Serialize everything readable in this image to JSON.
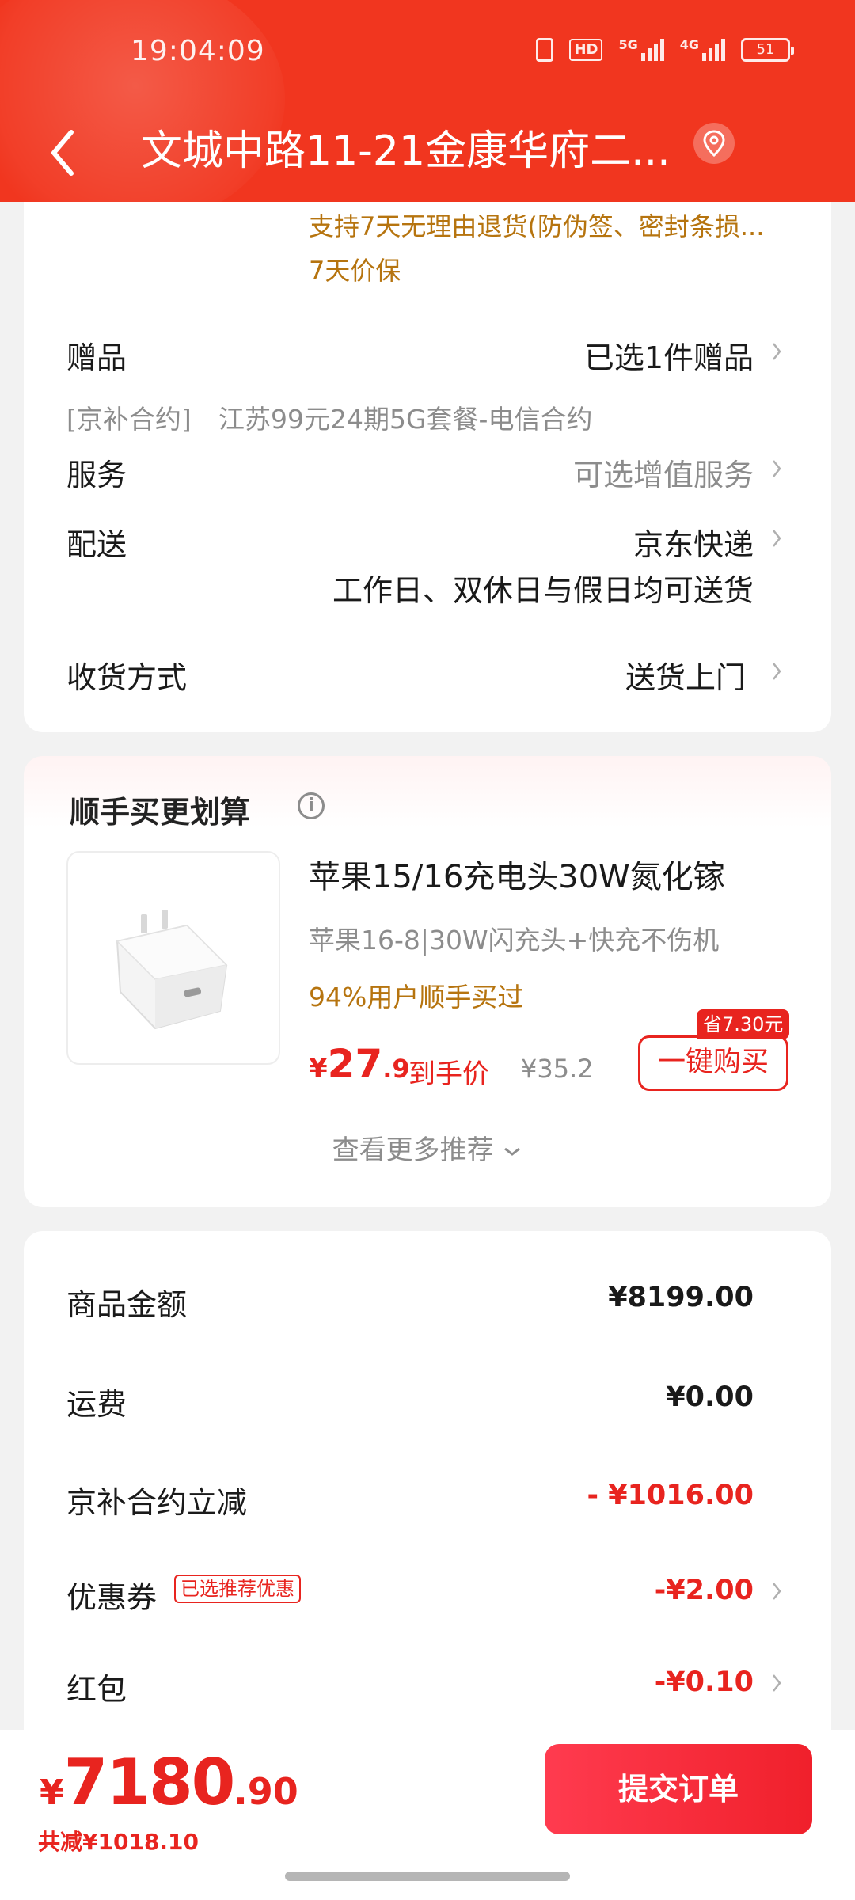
{
  "status_bar": {
    "time": "19:04:09",
    "hd": "HD",
    "net1": "5G",
    "net2": "4G",
    "battery": "51"
  },
  "nav": {
    "title": "文城中路11-21金康华府二..."
  },
  "product_info": {
    "return_policy": "支持7天无理由退货(防伪签、密封条损...",
    "price_protect": "7天价保",
    "gift_label": "赠品",
    "gift_value": "已选1件赠品",
    "contract_tag": "[京补合约]",
    "contract_desc": "江苏99元24期5G套餐-电信合约",
    "service_label": "服务",
    "service_value": "可选增值服务",
    "delivery_label": "配送",
    "delivery_value": "京东快递",
    "delivery_note": "工作日、双休日与假日均可送货",
    "receive_label": "收货方式",
    "receive_value": "送货上门"
  },
  "recommend": {
    "title": "顺手买更划算",
    "info_icon": "i",
    "product_name": "苹果15/16充电头30W氮化镓",
    "product_sub": "苹果16-8|30W闪充头+快充不伤机",
    "buy_rate": "94%用户顺手买过",
    "price_symbol": "¥",
    "price_int": "27",
    "price_dec": ".9",
    "price_label": "到手价",
    "orig_price": "¥35.2",
    "save_tag": "省7.30元",
    "buy_button": "一键购买",
    "more": "查看更多推荐"
  },
  "summary": {
    "rows": [
      {
        "label": "商品金额",
        "value": "¥8199.00"
      },
      {
        "label": "运费",
        "value": "¥0.00"
      },
      {
        "label": "京补合约立减",
        "value": "- ¥1016.00"
      },
      {
        "label": "优惠券",
        "tag": "已选推荐优惠",
        "value": "-¥2.00"
      },
      {
        "label": "红包",
        "value": "-¥0.10"
      }
    ]
  },
  "bottom": {
    "currency": "¥",
    "total_int": "7180",
    "total_dec": ".90",
    "saved": "共减¥1018.10",
    "submit": "提交订单"
  },
  "colors": {
    "header_red": "#f1361f",
    "accent_red": "#e8241f",
    "orange_text": "#b6740f"
  }
}
